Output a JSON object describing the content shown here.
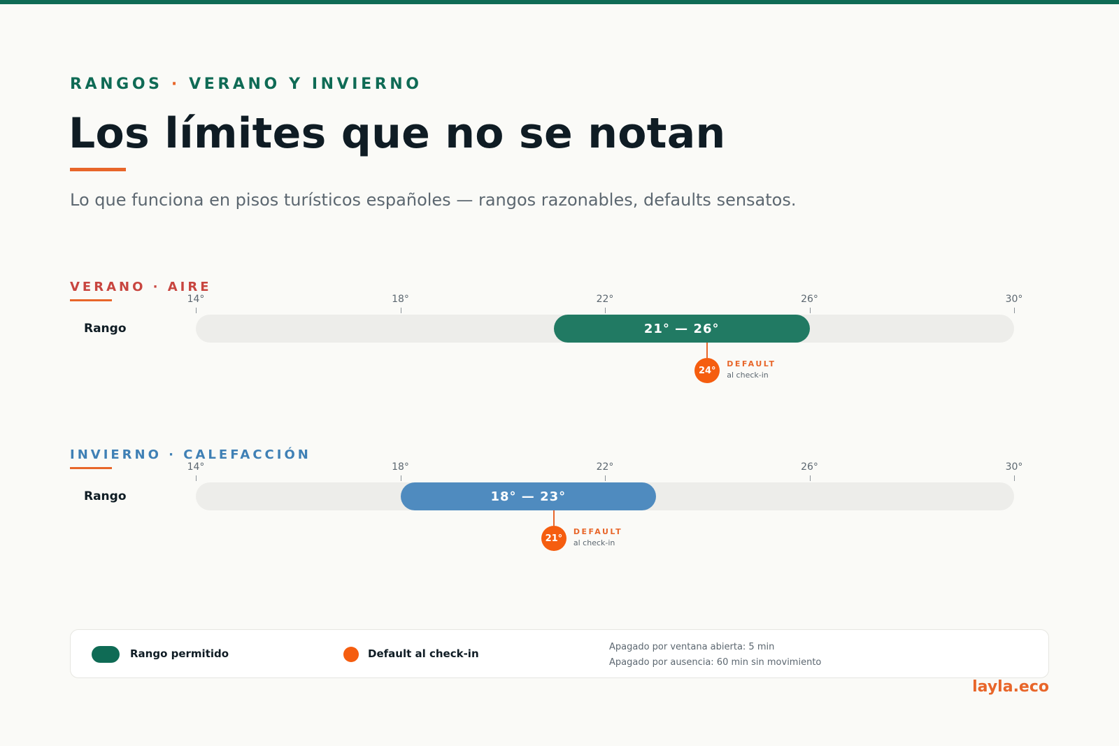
{
  "header": {
    "eyebrow_part1": "RANGOS",
    "eyebrow_sep": "·",
    "eyebrow_part2": "VERANO Y INVIERNO",
    "title": "Los límites que no se notan",
    "subtitle": "Lo que funciona en pisos turísticos españoles — rangos razonables, defaults sensatos."
  },
  "chart_data": [
    {
      "type": "bar",
      "title": "VERANO · AIRE",
      "title_color": "#c8453f",
      "row_label": "Rango",
      "axis_min": 14,
      "axis_max": 30,
      "ticks": [
        {
          "value": 14,
          "label": "14°"
        },
        {
          "value": 18,
          "label": "18°"
        },
        {
          "value": 22,
          "label": "22°"
        },
        {
          "value": 26,
          "label": "26°"
        },
        {
          "value": 30,
          "label": "30°"
        }
      ],
      "range_min": 21,
      "range_max": 26,
      "range_label": "21° — 26°",
      "range_color": "#217a63",
      "default_value": 24,
      "default_label": "24°",
      "default_title": "DEFAULT",
      "default_sub": "al check-in"
    },
    {
      "type": "bar",
      "title": "INVIERNO · CALEFACCIÓN",
      "title_color": "#3f80b5",
      "row_label": "Rango",
      "axis_min": 14,
      "axis_max": 30,
      "ticks": [
        {
          "value": 14,
          "label": "14°"
        },
        {
          "value": 18,
          "label": "18°"
        },
        {
          "value": 22,
          "label": "22°"
        },
        {
          "value": 26,
          "label": "26°"
        },
        {
          "value": 30,
          "label": "30°"
        }
      ],
      "range_min": 18,
      "range_max": 23,
      "range_label": "18° — 23°",
      "range_color": "#4f8bbf",
      "default_value": 21,
      "default_label": "21°",
      "default_title": "DEFAULT",
      "default_sub": "al check-in"
    }
  ],
  "legend": {
    "range_label": "Rango permitido",
    "default_label": "Default al check-in",
    "note_1": "Apagado por ventana abierta: 5 min",
    "note_2": "Apagado por ausencia: 60 min sin movimiento"
  },
  "brand": "layla.eco",
  "colors": {
    "primary": "#0f6b55",
    "accent": "#e8662a",
    "default_dot": "#f55d0f"
  }
}
